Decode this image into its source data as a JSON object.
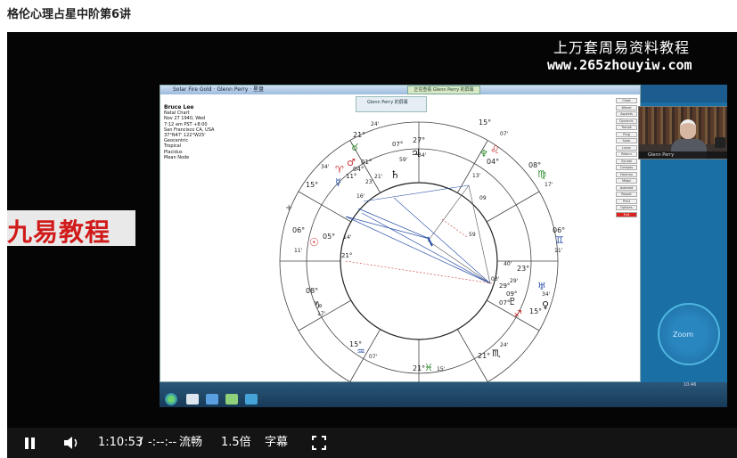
{
  "page": {
    "title": "格伦心理占星中阶第6讲"
  },
  "watermark": {
    "text_cn": "上万套周易资料教程",
    "url": "www.265zhouyiw.com"
  },
  "brand_banner": {
    "text": "九易教程"
  },
  "app": {
    "title": "Solar Fire Gold · Glenn Perry · 星盘",
    "notify_top": "正在查看 Glenn Perry 的屏幕",
    "notify_popup": "Glenn Perry 的屏幕"
  },
  "chart_info": {
    "name": "Bruce Lee",
    "type": "Natal Chart",
    "date": "Nov 27 1940, Wed",
    "time": "7:12 am  PST +8:00",
    "place": "San Francisco CA, USA",
    "coords": "37°N47' 122°W25'",
    "zodiac": "Geocentric",
    "system": "Tropical",
    "houses": "Placidus",
    "node": "Mean Node"
  },
  "chart_labels": [
    {
      "text": "21°"
    },
    {
      "text": "27°"
    },
    {
      "text": "07°"
    },
    {
      "text": "34'"
    },
    {
      "text": "59'"
    },
    {
      "text": "24'"
    },
    {
      "text": "15°"
    },
    {
      "text": "07'"
    },
    {
      "text": "04°"
    },
    {
      "text": "13'"
    },
    {
      "text": "08°"
    },
    {
      "text": "17'"
    },
    {
      "text": "21°"
    },
    {
      "text": "01°"
    },
    {
      "text": "04°"
    },
    {
      "text": "11°"
    },
    {
      "text": "21'"
    },
    {
      "text": "23'"
    },
    {
      "text": "34'"
    },
    {
      "text": "15°"
    },
    {
      "text": "06°"
    },
    {
      "text": "11'"
    },
    {
      "text": "05°"
    },
    {
      "text": "14'"
    },
    {
      "text": "06°"
    },
    {
      "text": "11'"
    },
    {
      "text": "40'"
    },
    {
      "text": "23°"
    },
    {
      "text": "29°"
    },
    {
      "text": "09°"
    },
    {
      "text": "07°"
    },
    {
      "text": "34'"
    },
    {
      "text": "15°"
    },
    {
      "text": "08°"
    },
    {
      "text": "17'"
    },
    {
      "text": "15°"
    },
    {
      "text": "07'"
    },
    {
      "text": "21°"
    },
    {
      "text": "15'"
    },
    {
      "text": "21°"
    },
    {
      "text": "24'"
    },
    {
      "text": "16'"
    },
    {
      "text": "03'"
    },
    {
      "text": "29'"
    },
    {
      "text": "59"
    },
    {
      "text": "09"
    }
  ],
  "side_buttons": [
    "Chart",
    "Wheel",
    "Aspects",
    "Dynamic",
    "Transit",
    "Prog",
    "Solar",
    "Lunar",
    "Return",
    "Synast",
    "Compos",
    "Harmon",
    "Midpt",
    "Asteroid",
    "Report",
    "Print",
    "Options",
    "Exit"
  ],
  "webcam": {
    "label": "Glenn Perry"
  },
  "desktop": {
    "logo_text": "Zoom",
    "clock": "10:46"
  },
  "controls": {
    "time_current": "1:10:53",
    "time_sep": "/",
    "time_total": "-:--:--",
    "quality": "流畅",
    "speed": "1.5倍",
    "subtitles": "字幕"
  }
}
